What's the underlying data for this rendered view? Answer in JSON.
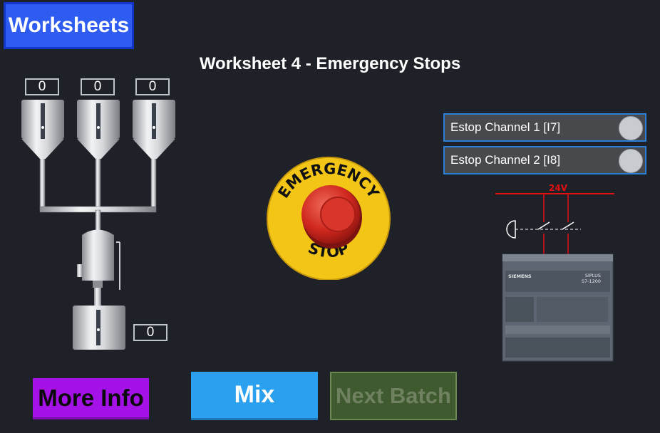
{
  "header": {
    "worksheets_label": "Worksheets",
    "title": "Worksheet 4 - Emergency Stops"
  },
  "tanks": {
    "tank1_value": "0",
    "tank2_value": "0",
    "tank3_value": "0",
    "output_value": "0"
  },
  "estop": {
    "channel1_label": "Estop Channel 1 [I7]",
    "channel2_label": "Estop Channel 2 [I8]"
  },
  "emergency_button": {
    "top_text": "EMERGENCY",
    "bottom_text": "STOP"
  },
  "wiring": {
    "voltage_label": "24V",
    "voltage_color": "#e01010"
  },
  "plc": {
    "brand": "SIEMENS",
    "model_line1": "SIPLUS",
    "model_line2": "S7-1200"
  },
  "buttons": {
    "more_info_label": "More Info",
    "mix_label": "Mix",
    "next_batch_label": "Next Batch"
  },
  "colors": {
    "worksheets": "#2f5cf0",
    "more_info": "#a512e8",
    "mix": "#2aa0ef",
    "next_batch": "#3f5a2e",
    "background": "#1f2128"
  }
}
